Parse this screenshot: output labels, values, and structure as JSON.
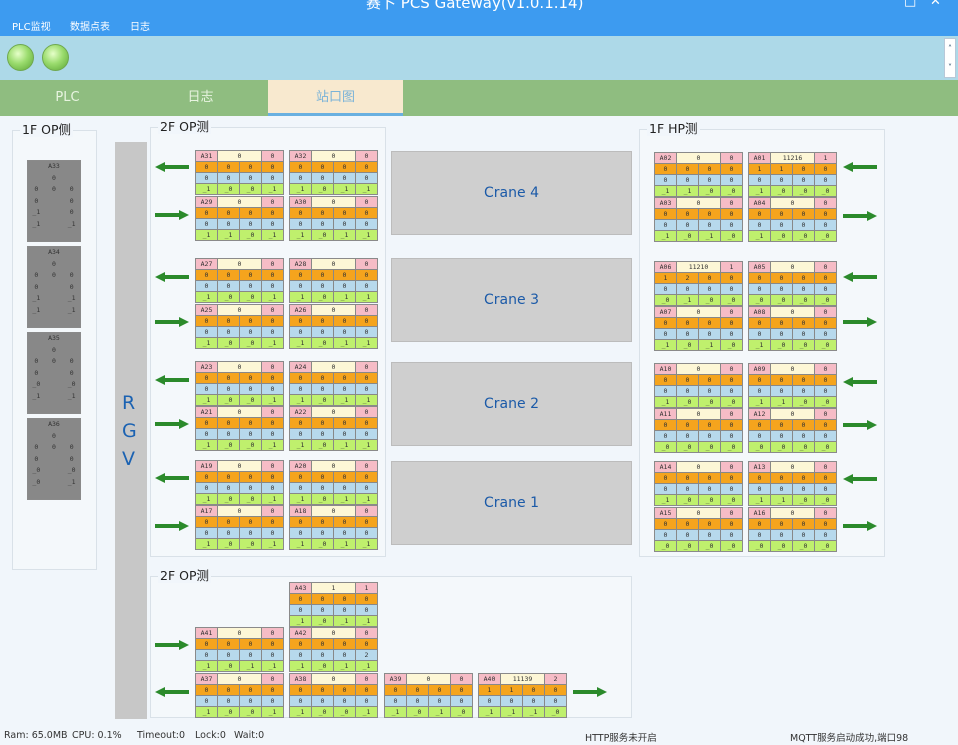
{
  "window": {
    "title": "赛卜 PCS Gateway(v1.0.1.14)",
    "window_controls": [
      "□",
      "✕"
    ]
  },
  "menu": [
    "PLC监视",
    "数据点表",
    "日志"
  ],
  "tabs": [
    {
      "label": "PLC"
    },
    {
      "label": "日志"
    },
    {
      "label": "站口图",
      "active": true
    }
  ],
  "groups": {
    "left": "1F OP侧",
    "mid_top": "2F OP测",
    "right": "1F HP测",
    "mid_bottom": "2F OP测"
  },
  "rgv": [
    "R",
    "G",
    "V"
  ],
  "cranes": [
    "Crane 4",
    "Crane 3",
    "Crane 2",
    "Crane 1"
  ],
  "left_stations": [
    {
      "name": "A33",
      "rows": [
        [
          "0"
        ],
        [
          "0",
          "0",
          "0"
        ],
        [
          "0",
          "",
          "0"
        ],
        [
          "_1",
          "",
          "0"
        ],
        [
          "_1",
          "",
          "_1"
        ]
      ]
    },
    {
      "name": "A34",
      "rows": [
        [
          "0"
        ],
        [
          "0",
          "0",
          "0"
        ],
        [
          "0",
          "",
          "0"
        ],
        [
          "_1",
          "",
          "_1"
        ],
        [
          "_1",
          "",
          "_1"
        ]
      ]
    },
    {
      "name": "A35",
      "rows": [
        [
          "0"
        ],
        [
          "0",
          "0",
          "0"
        ],
        [
          "0",
          "",
          "0"
        ],
        [
          "_0",
          "",
          "_0"
        ],
        [
          "_1",
          "",
          "_1"
        ]
      ]
    },
    {
      "name": "A36",
      "rows": [
        [
          "0"
        ],
        [
          "0",
          "0",
          "0"
        ],
        [
          "0",
          "",
          "0"
        ],
        [
          "_0",
          "",
          "_0"
        ],
        [
          "_0",
          "",
          "_1"
        ]
      ]
    }
  ],
  "stations": {
    "A31": {
      "v": "0",
      "f": "0",
      "r2": [
        "0",
        "0",
        "0",
        "0"
      ],
      "r3": [
        "0",
        "0",
        "0",
        "0"
      ],
      "r4": [
        "_1",
        "_0",
        "_0",
        "_1"
      ]
    },
    "A32": {
      "v": "0",
      "f": "0",
      "r2": [
        "0",
        "0",
        "0",
        "0"
      ],
      "r3": [
        "0",
        "0",
        "0",
        "0"
      ],
      "r4": [
        "_1",
        "_0",
        "_1",
        "_1"
      ]
    },
    "A29": {
      "v": "0",
      "f": "0",
      "r2": [
        "0",
        "0",
        "0",
        "0"
      ],
      "r3": [
        "0",
        "0",
        "0",
        "0"
      ],
      "r4": [
        "_1",
        "_1",
        "_0",
        "_1"
      ]
    },
    "A30": {
      "v": "0",
      "f": "0",
      "r2": [
        "0",
        "0",
        "0",
        "0"
      ],
      "r3": [
        "0",
        "0",
        "0",
        "0"
      ],
      "r4": [
        "_1",
        "_0",
        "_1",
        "_1"
      ]
    },
    "A27": {
      "v": "0",
      "f": "0",
      "r2": [
        "0",
        "0",
        "0",
        "0"
      ],
      "r3": [
        "0",
        "0",
        "0",
        "0"
      ],
      "r4": [
        "_1",
        "_0",
        "_0",
        "_1"
      ]
    },
    "A28": {
      "v": "0",
      "f": "0",
      "r2": [
        "0",
        "0",
        "0",
        "0"
      ],
      "r3": [
        "0",
        "0",
        "0",
        "0"
      ],
      "r4": [
        "_1",
        "_0",
        "_1",
        "_1"
      ]
    },
    "A25": {
      "v": "0",
      "f": "0",
      "r2": [
        "0",
        "0",
        "0",
        "0"
      ],
      "r3": [
        "0",
        "0",
        "0",
        "0"
      ],
      "r4": [
        "_1",
        "_0",
        "_0",
        "_1"
      ]
    },
    "A26": {
      "v": "0",
      "f": "0",
      "r2": [
        "0",
        "0",
        "0",
        "0"
      ],
      "r3": [
        "0",
        "0",
        "0",
        "0"
      ],
      "r4": [
        "_1",
        "_0",
        "_1",
        "_1"
      ]
    },
    "A23": {
      "v": "0",
      "f": "0",
      "r2": [
        "0",
        "0",
        "0",
        "0"
      ],
      "r3": [
        "0",
        "0",
        "0",
        "0"
      ],
      "r4": [
        "_1",
        "_0",
        "_0",
        "_1"
      ]
    },
    "A24": {
      "v": "0",
      "f": "0",
      "r2": [
        "0",
        "0",
        "0",
        "0"
      ],
      "r3": [
        "0",
        "0",
        "0",
        "0"
      ],
      "r4": [
        "_1",
        "_0",
        "_1",
        "_1"
      ]
    },
    "A21": {
      "v": "0",
      "f": "0",
      "r2": [
        "0",
        "0",
        "0",
        "0"
      ],
      "r3": [
        "0",
        "0",
        "0",
        "0"
      ],
      "r4": [
        "_1",
        "_0",
        "_0",
        "_1"
      ]
    },
    "A22": {
      "v": "0",
      "f": "0",
      "r2": [
        "0",
        "0",
        "0",
        "0"
      ],
      "r3": [
        "0",
        "0",
        "0",
        "0"
      ],
      "r4": [
        "_1",
        "_0",
        "_1",
        "_1"
      ]
    },
    "A19": {
      "v": "0",
      "f": "0",
      "r2": [
        "0",
        "0",
        "0",
        "0"
      ],
      "r3": [
        "0",
        "0",
        "0",
        "0"
      ],
      "r4": [
        "_1",
        "_0",
        "_0",
        "_1"
      ]
    },
    "A20": {
      "v": "0",
      "f": "0",
      "r2": [
        "0",
        "0",
        "0",
        "0"
      ],
      "r3": [
        "0",
        "0",
        "0",
        "0"
      ],
      "r4": [
        "_1",
        "_0",
        "_1",
        "_1"
      ]
    },
    "A17": {
      "v": "0",
      "f": "0",
      "r2": [
        "0",
        "0",
        "0",
        "0"
      ],
      "r3": [
        "0",
        "0",
        "0",
        "0"
      ],
      "r4": [
        "_1",
        "_0",
        "_0",
        "_1"
      ]
    },
    "A18": {
      "v": "0",
      "f": "0",
      "r2": [
        "0",
        "0",
        "0",
        "0"
      ],
      "r3": [
        "0",
        "0",
        "0",
        "0"
      ],
      "r4": [
        "_1",
        "_0",
        "_1",
        "_1"
      ]
    },
    "A02": {
      "v": "0",
      "f": "0",
      "r2": [
        "0",
        "0",
        "0",
        "0"
      ],
      "r3": [
        "0",
        "0",
        "0",
        "0"
      ],
      "r4": [
        "_1",
        "_1",
        "_0",
        "_0"
      ]
    },
    "A01": {
      "v": "11216",
      "f": "1",
      "r2": [
        "1",
        "1",
        "0",
        "0"
      ],
      "r3": [
        "0",
        "0",
        "0",
        "0"
      ],
      "r4": [
        "_1",
        "_0",
        "_0",
        "_0"
      ]
    },
    "A03": {
      "v": "0",
      "f": "0",
      "r2": [
        "0",
        "0",
        "0",
        "0"
      ],
      "r3": [
        "0",
        "0",
        "0",
        "0"
      ],
      "r4": [
        "_1",
        "_0",
        "_1",
        "_0"
      ]
    },
    "A04": {
      "v": "0",
      "f": "0",
      "r2": [
        "0",
        "0",
        "0",
        "0"
      ],
      "r3": [
        "0",
        "0",
        "0",
        "0"
      ],
      "r4": [
        "_1",
        "_0",
        "_0",
        "_0"
      ]
    },
    "A06": {
      "v": "11210",
      "f": "1",
      "r2": [
        "1",
        "2",
        "0",
        "0"
      ],
      "r3": [
        "0",
        "0",
        "0",
        "0"
      ],
      "r4": [
        "_0",
        "_1",
        "_0",
        "_0"
      ]
    },
    "A05": {
      "v": "0",
      "f": "0",
      "r2": [
        "0",
        "0",
        "0",
        "0"
      ],
      "r3": [
        "0",
        "0",
        "0",
        "0"
      ],
      "r4": [
        "_0",
        "_0",
        "_0",
        "_0"
      ]
    },
    "A07": {
      "v": "0",
      "f": "0",
      "r2": [
        "0",
        "0",
        "0",
        "0"
      ],
      "r3": [
        "0",
        "0",
        "0",
        "0"
      ],
      "r4": [
        "_1",
        "_0",
        "_1",
        "_0"
      ]
    },
    "A08": {
      "v": "0",
      "f": "0",
      "r2": [
        "0",
        "0",
        "0",
        "0"
      ],
      "r3": [
        "0",
        "0",
        "0",
        "0"
      ],
      "r4": [
        "_1",
        "_0",
        "_0",
        "_0"
      ]
    },
    "A10": {
      "v": "0",
      "f": "0",
      "r2": [
        "0",
        "0",
        "0",
        "0"
      ],
      "r3": [
        "0",
        "0",
        "0",
        "0"
      ],
      "r4": [
        "_1",
        "_0",
        "_0",
        "_0"
      ]
    },
    "A09": {
      "v": "0",
      "f": "0",
      "r2": [
        "0",
        "0",
        "0",
        "0"
      ],
      "r3": [
        "0",
        "0",
        "0",
        "0"
      ],
      "r4": [
        "_1",
        "_1",
        "_0",
        "_0"
      ]
    },
    "A11": {
      "v": "0",
      "f": "0",
      "r2": [
        "0",
        "0",
        "0",
        "0"
      ],
      "r3": [
        "0",
        "0",
        "0",
        "0"
      ],
      "r4": [
        "_0",
        "_0",
        "_0",
        "_0"
      ]
    },
    "A12": {
      "v": "0",
      "f": "0",
      "r2": [
        "0",
        "0",
        "0",
        "0"
      ],
      "r3": [
        "0",
        "0",
        "0",
        "0"
      ],
      "r4": [
        "_0",
        "_0",
        "_0",
        "_0"
      ]
    },
    "A14": {
      "v": "0",
      "f": "0",
      "r2": [
        "0",
        "0",
        "0",
        "0"
      ],
      "r3": [
        "0",
        "0",
        "0",
        "0"
      ],
      "r4": [
        "_1",
        "_0",
        "_0",
        "_0"
      ]
    },
    "A13": {
      "v": "0",
      "f": "0",
      "r2": [
        "0",
        "0",
        "0",
        "0"
      ],
      "r3": [
        "0",
        "0",
        "0",
        "0"
      ],
      "r4": [
        "_1",
        "_1",
        "_0",
        "_0"
      ]
    },
    "A15": {
      "v": "0",
      "f": "0",
      "r2": [
        "0",
        "0",
        "0",
        "0"
      ],
      "r3": [
        "0",
        "0",
        "0",
        "0"
      ],
      "r4": [
        "_0",
        "_0",
        "_0",
        "_0"
      ]
    },
    "A16": {
      "v": "0",
      "f": "0",
      "r2": [
        "0",
        "0",
        "0",
        "0"
      ],
      "r3": [
        "0",
        "0",
        "0",
        "0"
      ],
      "r4": [
        "_0",
        "_0",
        "_0",
        "_0"
      ]
    },
    "A43": {
      "v": "1",
      "f": "1",
      "r2": [
        "0",
        "0",
        "0",
        "0"
      ],
      "r3": [
        "0",
        "0",
        "0",
        "0"
      ],
      "r4": [
        "_1",
        "_0",
        "_1",
        "_1"
      ]
    },
    "A41": {
      "v": "0",
      "f": "0",
      "r2": [
        "0",
        "0",
        "0",
        "0"
      ],
      "r3": [
        "0",
        "0",
        "0",
        "0"
      ],
      "r4": [
        "_1",
        "_0",
        "_1",
        "_1"
      ]
    },
    "A42": {
      "v": "0",
      "f": "0",
      "r2": [
        "0",
        "0",
        "0",
        "0"
      ],
      "r3": [
        "0",
        "0",
        "0",
        "2"
      ],
      "r4": [
        "_1",
        "_0",
        "_1",
        "_1"
      ]
    },
    "A37": {
      "v": "0",
      "f": "0",
      "r2": [
        "0",
        "0",
        "0",
        "0"
      ],
      "r3": [
        "0",
        "0",
        "0",
        "0"
      ],
      "r4": [
        "_1",
        "_0",
        "_0",
        "_1"
      ]
    },
    "A38": {
      "v": "0",
      "f": "0",
      "r2": [
        "0",
        "0",
        "0",
        "0"
      ],
      "r3": [
        "0",
        "0",
        "0",
        "0"
      ],
      "r4": [
        "_1",
        "_0",
        "_0",
        "_1"
      ]
    },
    "A39": {
      "v": "0",
      "f": "0",
      "r2": [
        "0",
        "0",
        "0",
        "0"
      ],
      "r3": [
        "0",
        "0",
        "0",
        "0"
      ],
      "r4": [
        "_1",
        "_0",
        "_1",
        "_0"
      ]
    },
    "A40": {
      "v": "11139",
      "f": "2",
      "r2": [
        "1",
        "1",
        "0",
        "0"
      ],
      "r3": [
        "0",
        "0",
        "0",
        "0"
      ],
      "r4": [
        "_1",
        "_1",
        "_1",
        "_0"
      ]
    }
  },
  "arrows": {
    "color": "#2b8a2b"
  },
  "colors": {
    "name": "#f6bcc6",
    "value": "#fdf7d6",
    "orange": "#f5a41d",
    "blue": "#b7d9ec",
    "green": "#bff06d",
    "accent": "#3d9bf0"
  },
  "status": {
    "ram": "Ram: 65.0MB",
    "cpu": "CPU: 0.1%",
    "timeout": "Timeout:0",
    "lock": "Lock:0",
    "wait": "Wait:0",
    "http": "HTTP服务未开启",
    "mqtt": "MQTT服务启动成功,端口98"
  }
}
